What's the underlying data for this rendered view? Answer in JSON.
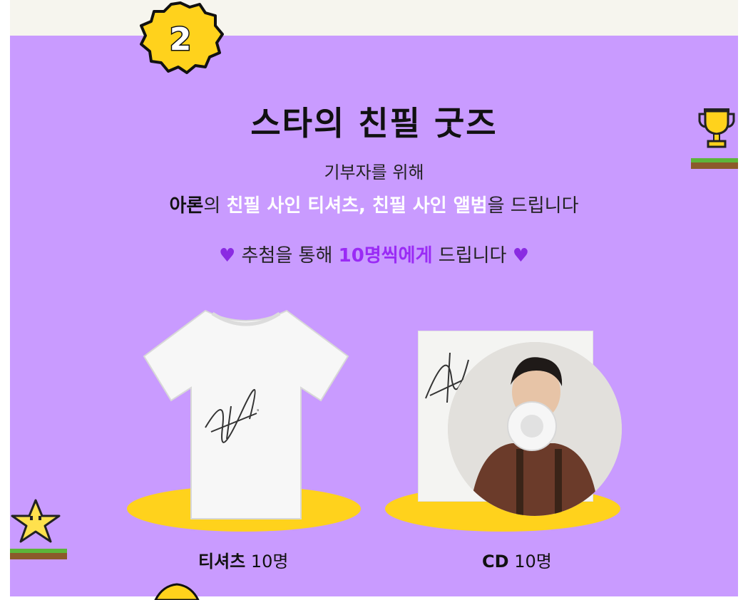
{
  "badge": {
    "number": "2",
    "fill": "#ffd21c"
  },
  "section": {
    "title": "스타의 친필 굿즈",
    "subtitle": "기부자를 위해",
    "desc": {
      "star_name": "아론",
      "particle": "의 ",
      "items_highlight": "친필 사인 티셔츠, 친필 사인 앨범",
      "suffix": "을 드립니다"
    },
    "lottery": {
      "prefix": "추첨을 통해 ",
      "highlight": "10명씩에게",
      "suffix": " 드립니다"
    }
  },
  "products": [
    {
      "name": "티셔츠",
      "count": "10명",
      "icon": "signed-tshirt"
    },
    {
      "name": "CD",
      "count": "10명",
      "icon": "signed-cd-album"
    }
  ],
  "colors": {
    "panel": "#c99bff",
    "accent_yellow": "#ffd21c",
    "highlight_purple": "#9a2bf5"
  },
  "decor": [
    "trophy-icon",
    "star-icon",
    "heart-icon"
  ]
}
